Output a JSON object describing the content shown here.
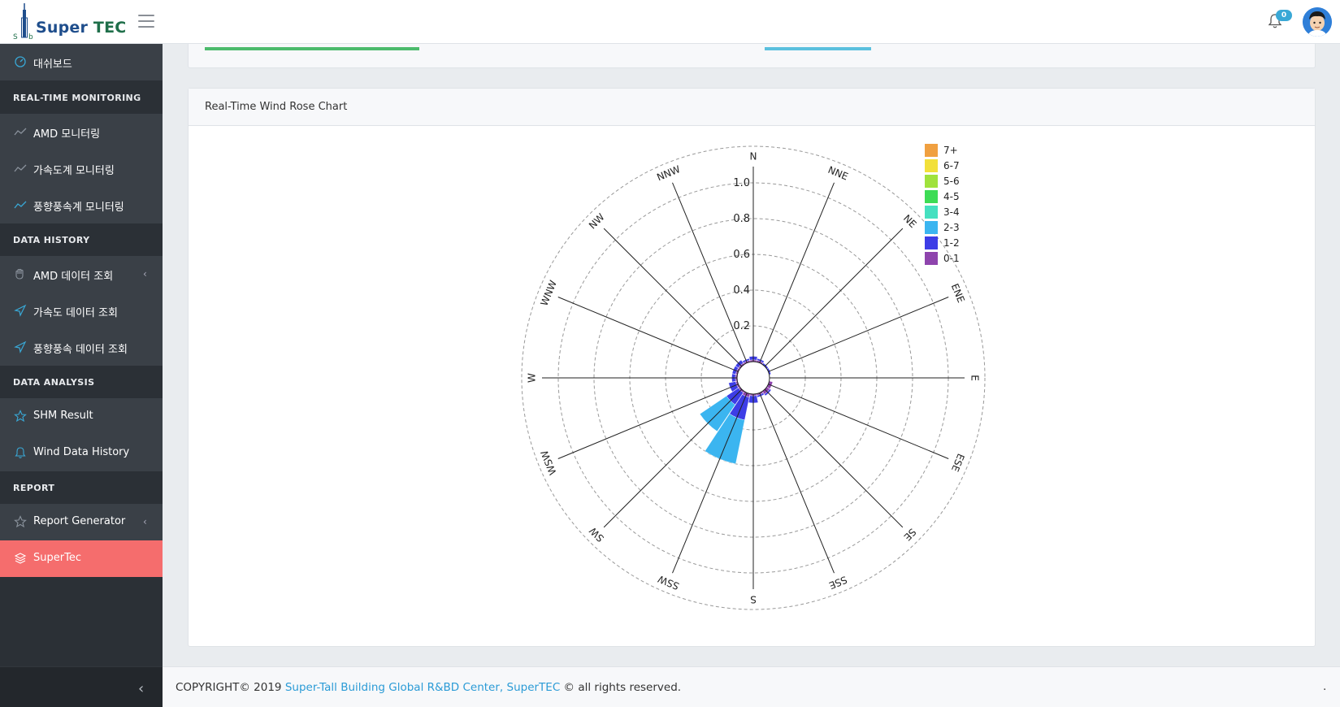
{
  "app": {
    "brand_primary": "Super",
    "brand_secondary": "TEC",
    "notification_count": "0",
    "accent_color": "#f56d6d",
    "sidebar_bg": "#2b3036"
  },
  "sidebar": {
    "dashboard_label": "대쉬보드",
    "sections": [
      {
        "heading": "REAL-TIME MONITORING"
      },
      {
        "heading": "DATA HISTORY"
      },
      {
        "heading": "DATA ANALYSIS"
      },
      {
        "heading": "REPORT"
      }
    ],
    "items": [
      {
        "label": "AMD 모니터링",
        "icon": "trend-line-icon"
      },
      {
        "label": "가속도계 모니터링",
        "icon": "trend-line-icon"
      },
      {
        "label": "풍향풍속계 모니터링",
        "icon": "trend-line-icon"
      },
      {
        "label": "AMD 데이터 조회",
        "icon": "hand-icon"
      },
      {
        "label": "가속도 데이터 조회",
        "icon": "send-icon"
      },
      {
        "label": "풍향풍속 데이터 조회",
        "icon": "send-icon"
      },
      {
        "label": "SHM Result",
        "icon": "star-icon"
      },
      {
        "label": "Wind Data History",
        "icon": "bell-icon"
      },
      {
        "label": "Report Generator",
        "icon": "star-icon"
      },
      {
        "label": "SuperTec",
        "icon": "layers-icon"
      }
    ]
  },
  "chart_card": {
    "title": "Real-Time Wind Rose Chart"
  },
  "chart_data": {
    "type": "barpolar",
    "directions": [
      "N",
      "NNE",
      "NE",
      "ENE",
      "E",
      "ESE",
      "SE",
      "SSE",
      "S",
      "SSW",
      "SW",
      "WSW",
      "W",
      "WNW",
      "NW",
      "NNW"
    ],
    "radial_ticks": [
      "0.2",
      "0.4",
      "0.6",
      "0.8",
      "1.0"
    ],
    "rlim": [
      0,
      1.0
    ],
    "grid": true,
    "legend_position": "top-right",
    "series": [
      {
        "name": "0-1",
        "color": "#8e44ad",
        "values": [
          0.01,
          0.01,
          0,
          0,
          0,
          0.02,
          0.02,
          0.01,
          0.01,
          0.02,
          0.01,
          0.01,
          0.01,
          0.01,
          0.01,
          0.01
        ]
      },
      {
        "name": "1-2",
        "color": "#3d3de6",
        "values": [
          0.02,
          0.01,
          0.01,
          0.01,
          0,
          0,
          0.01,
          0.01,
          0.04,
          0.13,
          0.08,
          0.04,
          0.02,
          0.02,
          0.02,
          0.01
        ]
      },
      {
        "name": "2-3",
        "color": "#3bb5f0",
        "values": [
          0,
          0,
          0,
          0,
          0,
          0,
          0,
          0,
          0,
          0.25,
          0.18,
          0,
          0,
          0,
          0,
          0
        ]
      },
      {
        "name": "3-4",
        "color": "#45e0c0",
        "values": [
          0,
          0,
          0,
          0,
          0,
          0,
          0,
          0,
          0,
          0,
          0,
          0,
          0,
          0,
          0,
          0
        ]
      },
      {
        "name": "4-5",
        "color": "#3ddc55",
        "values": [
          0,
          0,
          0,
          0,
          0,
          0,
          0,
          0,
          0,
          0,
          0,
          0,
          0,
          0,
          0,
          0
        ]
      },
      {
        "name": "5-6",
        "color": "#a0e23c",
        "values": [
          0,
          0,
          0,
          0,
          0,
          0,
          0,
          0,
          0,
          0,
          0,
          0,
          0,
          0,
          0,
          0
        ]
      },
      {
        "name": "6-7",
        "color": "#f2e03a",
        "values": [
          0,
          0,
          0,
          0,
          0,
          0,
          0,
          0,
          0,
          0,
          0,
          0,
          0,
          0,
          0,
          0
        ]
      },
      {
        "name": "7+",
        "color": "#f0a040",
        "values": [
          0,
          0,
          0,
          0,
          0,
          0,
          0,
          0,
          0,
          0,
          0,
          0,
          0,
          0,
          0,
          0
        ]
      }
    ]
  },
  "footer": {
    "copyright_prefix": "COPYRIGHT© 2019",
    "link_text": "Super-Tall Building Global R&BD Center, SuperTEC",
    "copyright_suffix": "© all rights reserved.",
    "trailing": "."
  }
}
